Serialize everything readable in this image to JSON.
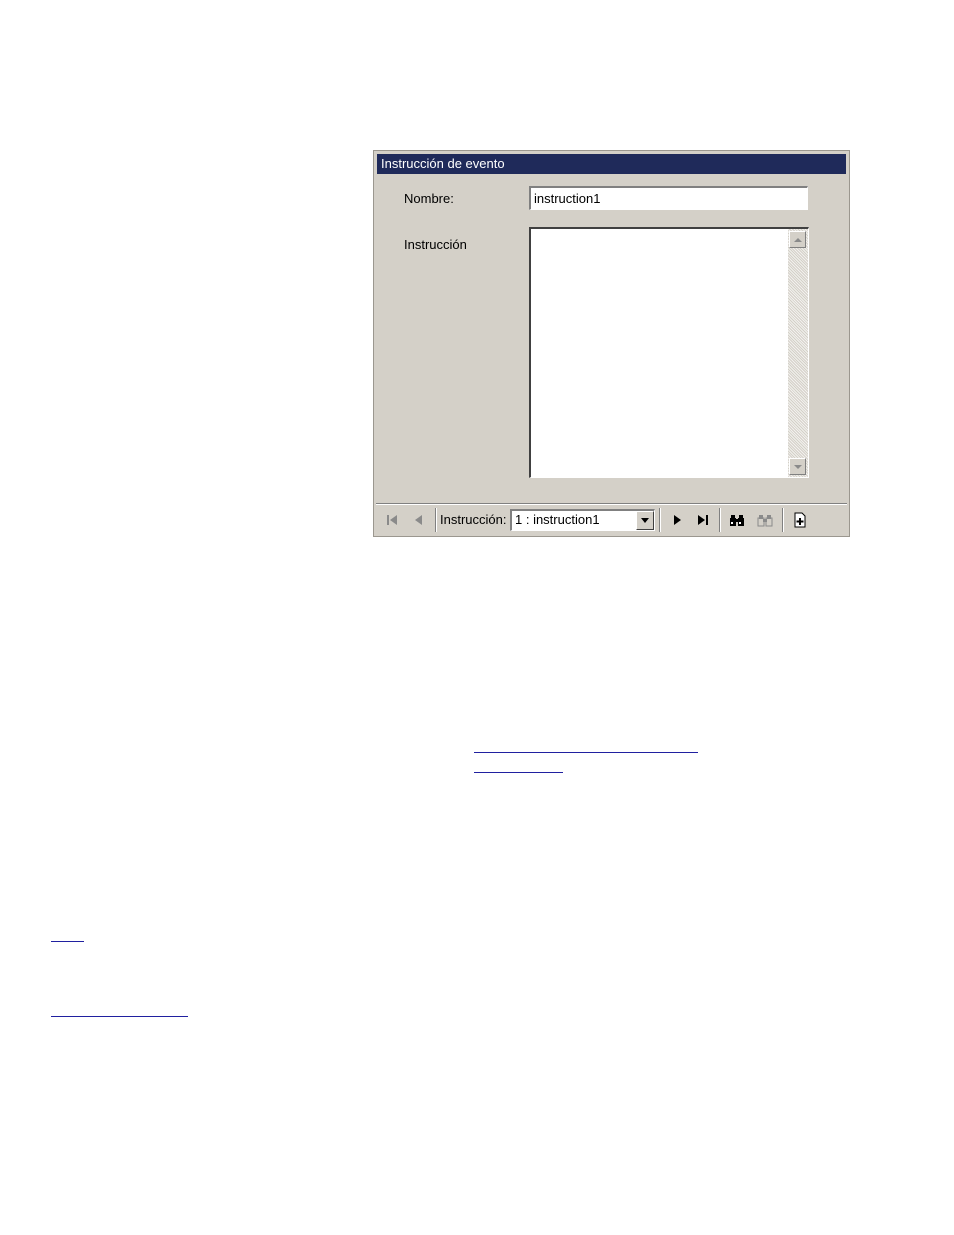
{
  "dialog": {
    "title": "Instrucción de evento",
    "name_label": "Nombre:",
    "name_value": "instruction1",
    "instruction_label": "Instrucción",
    "instruction_text": ""
  },
  "navigator": {
    "label": "Instrucción:",
    "selected": "1 : instruction1"
  },
  "icons": {
    "first": "first-record-icon",
    "prev": "previous-record-icon",
    "next": "next-record-icon",
    "last": "last-record-icon",
    "find": "binoculars-icon",
    "find_next": "binoculars-disabled-icon",
    "new": "new-record-icon"
  },
  "colors": {
    "titlebar": "#1f2a5a",
    "dialog_bg": "#d4d0c8",
    "link": "#2020a0"
  }
}
